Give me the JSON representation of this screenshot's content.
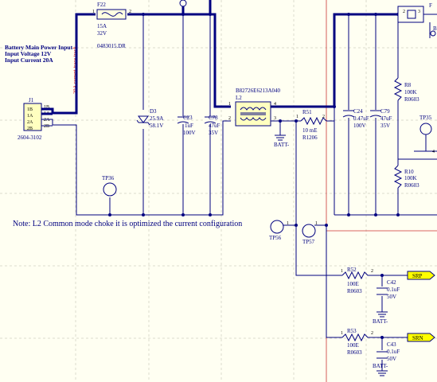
{
  "note": "Note: L2 Common mode choke it is optimized the current configuration",
  "input_block": {
    "title": "Battery Main Power Input",
    "voltage": "Input Voltage 12V",
    "current": "Input Current 20A",
    "trace_note": "20A current trace track"
  },
  "components": {
    "j1": {
      "ref": "J1",
      "part": "2604-3102",
      "pins": [
        "1B",
        "1A",
        "2A",
        "2B"
      ],
      "pin_nums": [
        "1B",
        "1A",
        "2A",
        "2B"
      ]
    },
    "f22": {
      "ref": "F22",
      "rating": "15A",
      "voltage": "32V",
      "part": "0483015.DR"
    },
    "d3": {
      "ref": "D3",
      "v1": "25.9A",
      "v2": "58.1V"
    },
    "c23": {
      "ref": "C23",
      "v1": "1uF",
      "v2": "100V"
    },
    "c78": {
      "ref": "C78",
      "v1": "47uF",
      "v2": "35V"
    },
    "l2": {
      "ref": "L2",
      "part": "B82726E6213A040"
    },
    "r51": {
      "ref": "R51",
      "v1": "10 mE",
      "v2": "R1206"
    },
    "c24": {
      "ref": "C24",
      "v1": "0.47uF",
      "v2": "100V"
    },
    "c79": {
      "ref": "C79",
      "v1": "47uF",
      "v2": "35V"
    },
    "r8": {
      "ref": "R8",
      "v1": "100K",
      "v2": "R0603"
    },
    "r10": {
      "ref": "R10",
      "v1": "100K",
      "v2": "R0603"
    },
    "r52": {
      "ref": "R52",
      "v1": "100E",
      "v2": "R0603"
    },
    "c42": {
      "ref": "C42",
      "v1": "0.1uF",
      "v2": "50V"
    },
    "r53": {
      "ref": "R53",
      "v1": "100E",
      "v2": "R0603"
    },
    "c43": {
      "ref": "C43",
      "v1": "0.1uF",
      "v2": "50V"
    },
    "tp36": {
      "ref": "TP36"
    },
    "tp56": {
      "ref": "TP56"
    },
    "tp57": {
      "ref": "TP57"
    },
    "tp35": {
      "ref": "TP35"
    }
  },
  "nets": {
    "batt_minus": "BATT-",
    "srp": "SRP",
    "srn": "SRN"
  },
  "pin_numbers": {
    "one": "1",
    "two": "2",
    "three": "3",
    "four": "4"
  },
  "partial": {
    "f_right": "F",
    "u_letter": "B"
  }
}
